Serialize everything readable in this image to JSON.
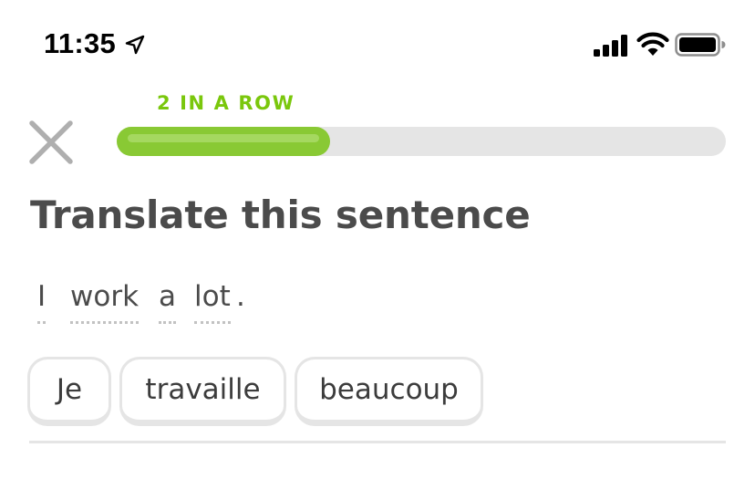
{
  "status_bar": {
    "time": "11:35",
    "icons": [
      "location-arrow-icon",
      "cellular-signal-icon",
      "wifi-icon",
      "battery-icon"
    ]
  },
  "lesson": {
    "streak_label": "2 IN A ROW",
    "progress_fraction": 0.35,
    "close_icon": "close-icon"
  },
  "challenge": {
    "instruction": "Translate this sentence",
    "prompt_words": [
      "I",
      "work",
      "a",
      "lot"
    ],
    "prompt_punctuation": "."
  },
  "word_bank": {
    "tiles": [
      "Je",
      "travaille",
      "beaucoup"
    ]
  },
  "colors": {
    "accent_green": "#89c934",
    "streak_green": "#7ac70c",
    "track_gray": "#e5e5e5",
    "text_dark": "#4b4b4b"
  }
}
